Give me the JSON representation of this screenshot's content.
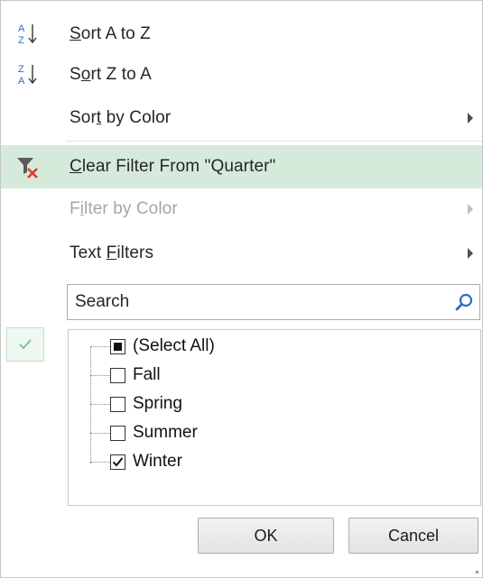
{
  "menu": {
    "sort_az": {
      "pre": "",
      "ul": "S",
      "post": "ort A to Z"
    },
    "sort_za": {
      "pre": "S",
      "ul": "o",
      "post": "rt Z to A"
    },
    "sort_by_color": {
      "pre": "Sor",
      "ul": "t",
      "post": " by Color"
    },
    "clear_filter": {
      "pre": "",
      "ul": "C",
      "post": "lear Filter From \"Quarter\""
    },
    "filter_by_color": {
      "pre": "F",
      "ul": "i",
      "post": "lter by Color"
    },
    "text_filters": {
      "pre": "Text ",
      "ul": "F",
      "post": "ilters"
    }
  },
  "search": {
    "placeholder": "Search",
    "value": ""
  },
  "values_list": [
    {
      "label": "(Select All)",
      "state": "partial"
    },
    {
      "label": "Fall",
      "state": "unchecked"
    },
    {
      "label": "Spring",
      "state": "unchecked"
    },
    {
      "label": "Summer",
      "state": "unchecked"
    },
    {
      "label": "Winter",
      "state": "checked"
    }
  ],
  "buttons": {
    "ok": "OK",
    "cancel": "Cancel"
  },
  "colors": {
    "highlight": "#d6eadc",
    "disabled_text": "#a6a6a6",
    "icon_blue": "#2e6fc4",
    "icon_red": "#e23b2e",
    "check_green": "#7fbf8a"
  },
  "icons": {
    "sort_az": "sort-ascending-icon",
    "sort_za": "sort-descending-icon",
    "clear_filter": "clear-filter-icon",
    "search": "search-icon",
    "selection_check": "checkmark-icon"
  }
}
